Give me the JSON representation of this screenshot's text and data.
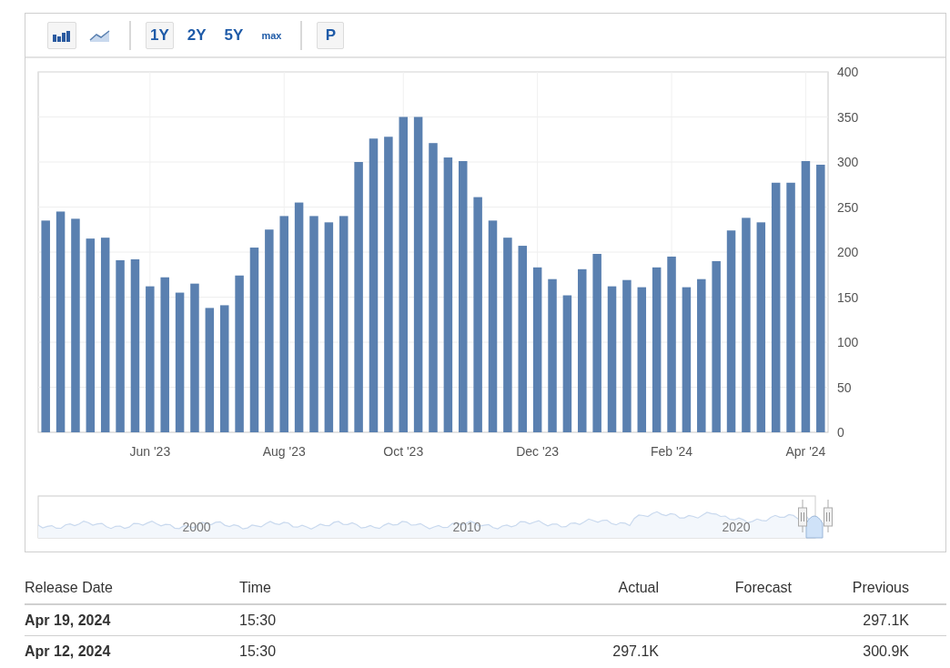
{
  "toolbar": {
    "chart_types": [
      {
        "kind": "bar",
        "selected": true
      },
      {
        "kind": "line",
        "selected": false
      }
    ],
    "ranges": [
      {
        "label": "1Y",
        "selected": true,
        "kind": "big"
      },
      {
        "label": "2Y",
        "selected": false,
        "kind": "big"
      },
      {
        "label": "5Y",
        "selected": false,
        "kind": "big"
      },
      {
        "label": "max",
        "selected": false,
        "kind": "small"
      }
    ],
    "p_button": {
      "label": "P"
    }
  },
  "chart": {
    "chart_data": {
      "type": "bar",
      "categories": [
        null,
        null,
        null,
        null,
        null,
        null,
        null,
        "Jun '23",
        null,
        null,
        null,
        null,
        null,
        null,
        null,
        null,
        "Aug '23",
        null,
        null,
        null,
        null,
        null,
        null,
        null,
        "Oct '23",
        null,
        null,
        null,
        null,
        null,
        null,
        null,
        null,
        "Dec '23",
        null,
        null,
        null,
        null,
        null,
        null,
        null,
        null,
        "Feb '24",
        null,
        null,
        null,
        null,
        null,
        null,
        null,
        null,
        "Apr '24",
        null
      ],
      "grid": true,
      "series": [
        {
          "color": "#5a80b0",
          "values": [
            235,
            245,
            237,
            215,
            216,
            191,
            192,
            162,
            172,
            155,
            165,
            138,
            141,
            174,
            205,
            225,
            240,
            255,
            240,
            233,
            240,
            300,
            326,
            328,
            350,
            350,
            321,
            305,
            301,
            261,
            235,
            216,
            207,
            183,
            170,
            152,
            181,
            198,
            162,
            169,
            161,
            183,
            195,
            161,
            170,
            190,
            224,
            238,
            233,
            277,
            277,
            301,
            297
          ]
        }
      ],
      "ylim": [
        0,
        400
      ],
      "yticks": [
        0,
        50,
        100,
        150,
        200,
        250,
        300,
        350,
        400
      ]
    }
  },
  "navigator": {
    "year_labels": [
      "2000",
      "2010",
      "2020"
    ]
  },
  "table": {
    "columns": [
      "Release Date",
      "Time",
      "Actual",
      "Forecast",
      "Previous"
    ],
    "rows": [
      {
        "release_date": "Apr 19, 2024",
        "time": "15:30",
        "previous": "297.1K"
      },
      {
        "release_date": "Apr 12, 2024",
        "time": "15:30",
        "actual": "297.1K",
        "previous": "300.9K"
      }
    ]
  }
}
